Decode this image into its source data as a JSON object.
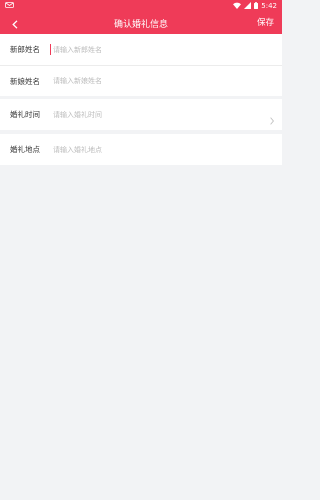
{
  "status_bar": {
    "time": "5:42",
    "icons": [
      "notification-icon",
      "wifi-icon",
      "cellular-signal-icon",
      "battery-icon"
    ]
  },
  "header": {
    "title": "确认婚礼信息",
    "save_label": "保存",
    "back_icon": "back-arrow-icon"
  },
  "form": {
    "groom": {
      "label": "新郎姓名",
      "placeholder": "请输入新郎姓名",
      "value": ""
    },
    "bride": {
      "label": "新娘姓名",
      "placeholder": "请输入新娘姓名",
      "value": ""
    },
    "wedding_time": {
      "label": "婚礼时间",
      "placeholder": "请输入婚礼时间",
      "value": ""
    },
    "wedding_place": {
      "label": "婚礼地点",
      "placeholder": "请输入婚礼地点",
      "value": ""
    }
  },
  "colors": {
    "accent": "#ef3b58",
    "background": "#f2f3f5",
    "label": "#333333",
    "placeholder": "#bbbbbb"
  }
}
